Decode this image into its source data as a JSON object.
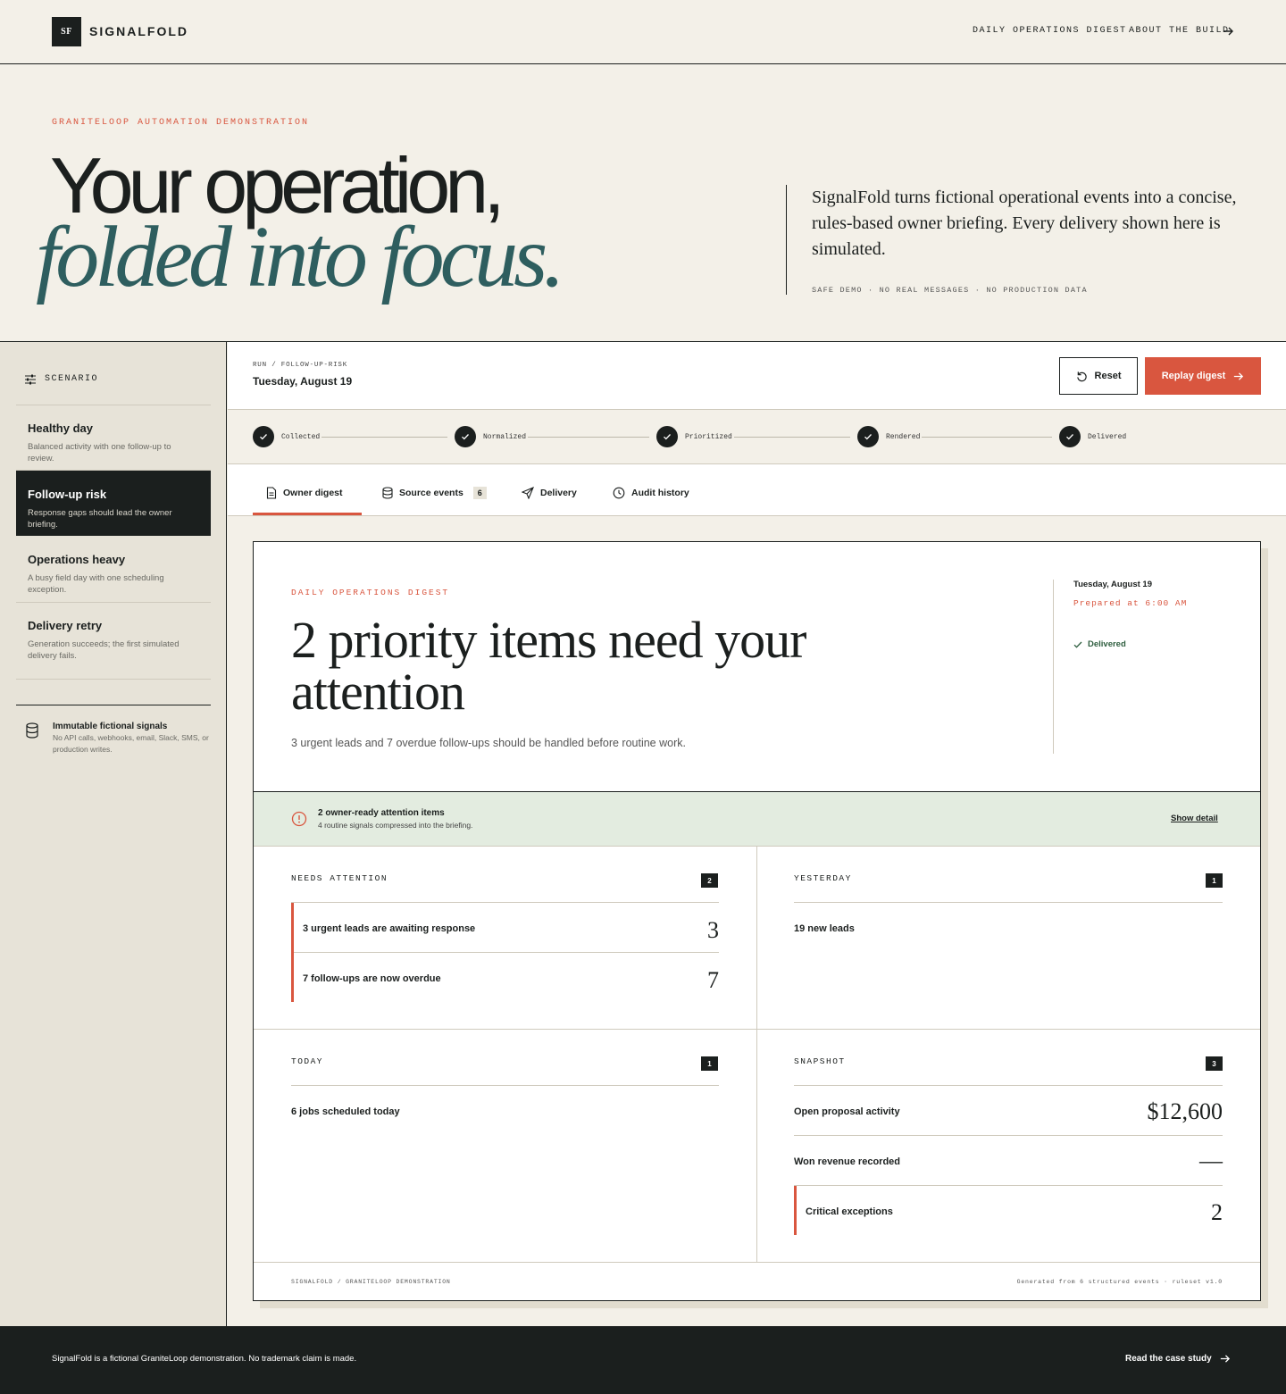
{
  "nav": {
    "logo_mark": "SF",
    "brand": "SIGNALFOLD",
    "links": [
      "DAILY OPERATIONS DIGEST",
      "ABOUT THE BUILD"
    ]
  },
  "hero": {
    "eyebrow": "GRANITELOOP AUTOMATION DEMONSTRATION",
    "headline_1": "Your operation,",
    "headline_2": "folded into focus.",
    "description": "SignalFold turns fictional operational events into a concise, rules-based owner briefing. Every delivery shown here is simulated.",
    "meta": "SAFE DEMO · NO REAL MESSAGES · NO PRODUCTION DATA"
  },
  "sidebar": {
    "heading": "SCENARIO",
    "items": [
      {
        "title": "Healthy day",
        "desc": "Balanced activity with one follow-up to review."
      },
      {
        "title": "Follow-up risk",
        "desc": "Response gaps should lead the owner briefing."
      },
      {
        "title": "Operations heavy",
        "desc": "A busy field day with one scheduling exception."
      },
      {
        "title": "Delivery retry",
        "desc": "Generation succeeds; the first simulated delivery fails."
      }
    ],
    "active_index": 1,
    "note_title": "Immutable fictional signals",
    "note_desc": "No API calls, webhooks, email, Slack, SMS, or production writes."
  },
  "run": {
    "crumb": "RUN / FOLLOW-UP-RISK",
    "date": "Tuesday, August 19",
    "reset_label": "Reset",
    "replay_label": "Replay digest"
  },
  "steps": [
    "Collected",
    "Normalized",
    "Prioritized",
    "Rendered",
    "Delivered"
  ],
  "tabs": [
    {
      "label": "Owner digest"
    },
    {
      "label": "Source events",
      "count": "6"
    },
    {
      "label": "Delivery"
    },
    {
      "label": "Audit history"
    }
  ],
  "digest": {
    "eyebrow": "DAILY OPERATIONS DIGEST",
    "title": "2 priority items need your attention",
    "subtitle": "3 urgent leads and 7 overdue follow-ups should be handled before routine work.",
    "date": "Tuesday, August 19",
    "prepared": "Prepared at 6:00 AM",
    "status": "Delivered",
    "alert_title": "2 owner-ready attention items",
    "alert_desc": "4 routine signals compressed into the briefing.",
    "alert_link": "Show detail",
    "needs_attention": {
      "heading": "NEEDS ATTENTION",
      "count": "2",
      "rows": [
        {
          "label": "3 urgent leads are awaiting response",
          "value": "3"
        },
        {
          "label": "7 follow-ups are now overdue",
          "value": "7"
        }
      ]
    },
    "yesterday": {
      "heading": "YESTERDAY",
      "count": "1",
      "rows": [
        {
          "label": "19 new leads"
        }
      ]
    },
    "today": {
      "heading": "TODAY",
      "count": "1",
      "rows": [
        {
          "label": "6 jobs scheduled today"
        }
      ]
    },
    "snapshot": {
      "heading": "SNAPSHOT",
      "count": "3",
      "rows": [
        {
          "label": "Open proposal activity",
          "value": "$12,600"
        },
        {
          "label": "Won revenue recorded",
          "value": "—"
        },
        {
          "label": "Critical exceptions",
          "value": "2"
        }
      ]
    },
    "footer_left": "SIGNALFOLD / GRANITELOOP DEMONSTRATION",
    "footer_right": "Generated from 6 structured events · ruleset v1.0"
  },
  "footer": {
    "text": "SignalFold is a fictional GraniteLoop demonstration. No trademark claim is made.",
    "link": "Read the case study"
  },
  "colors": {
    "accent": "#d9563f",
    "ink": "#1b1f1e",
    "teal": "#2e5e5f",
    "paper": "#f3f0e8",
    "alert_bg": "#e3ece0"
  }
}
